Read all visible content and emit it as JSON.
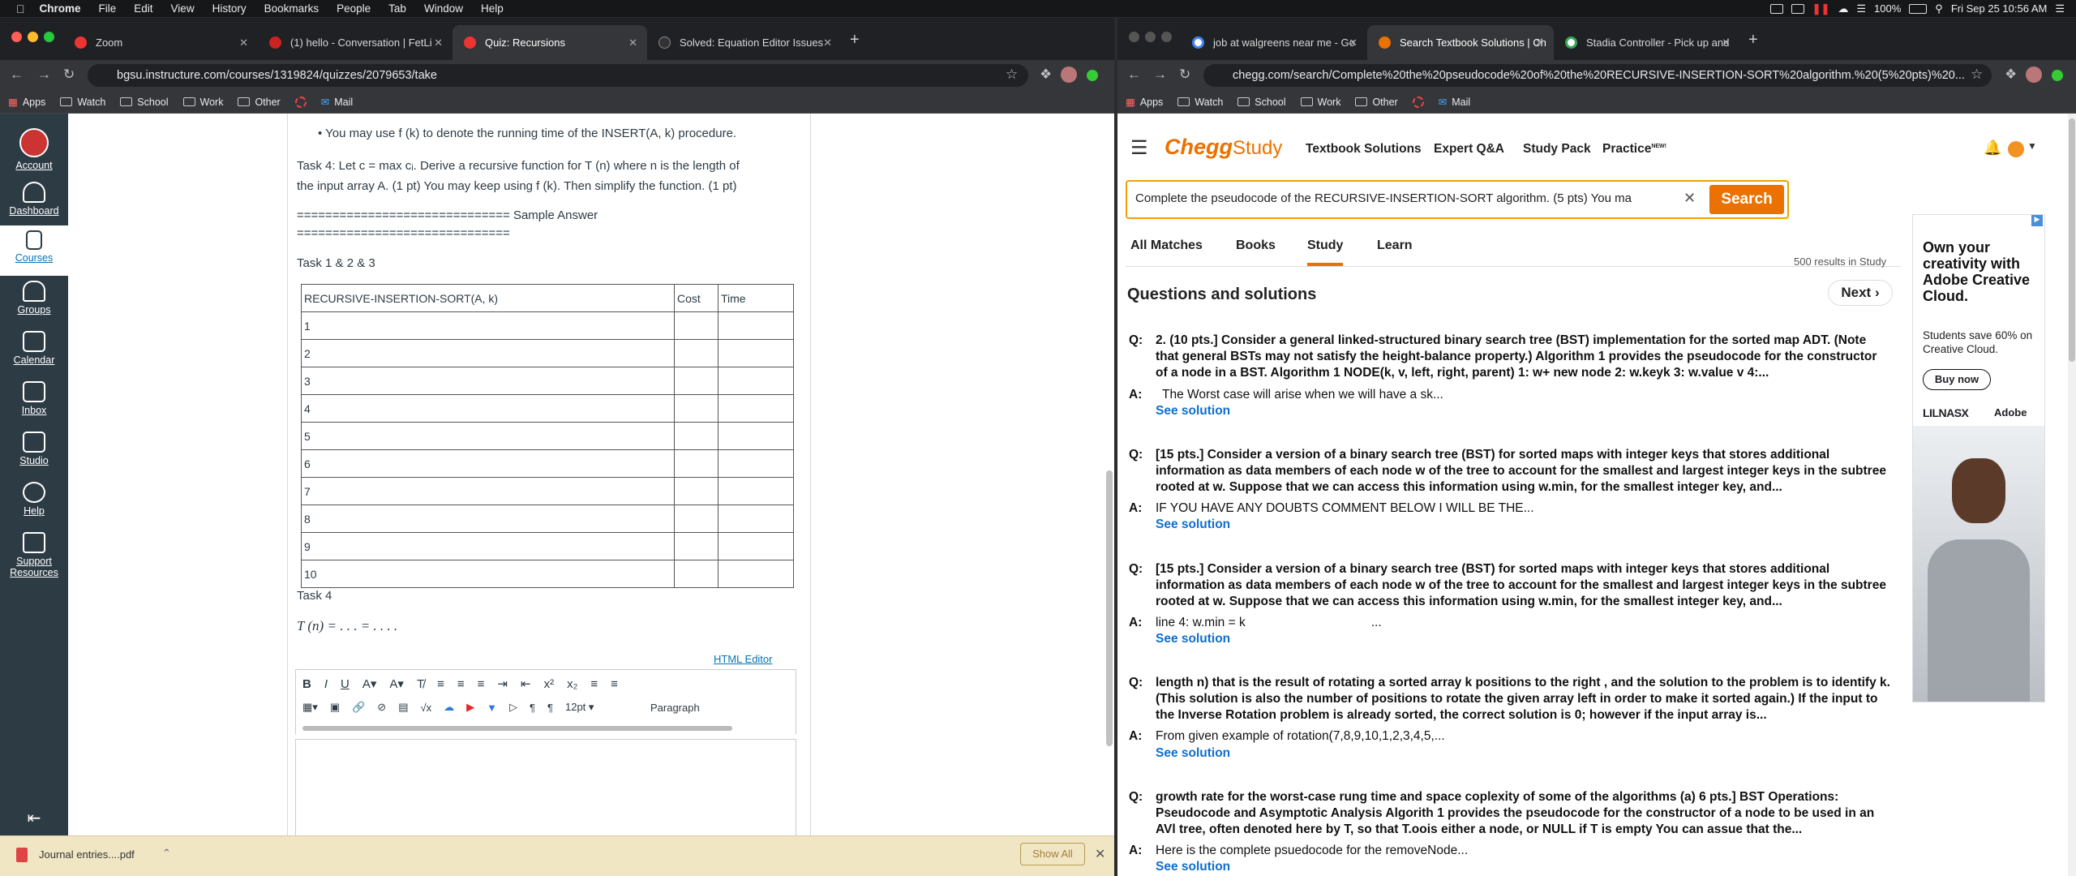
{
  "menubar": {
    "app": "Chrome",
    "items": [
      "File",
      "Edit",
      "View",
      "History",
      "Bookmarks",
      "People",
      "Tab",
      "Window",
      "Help"
    ],
    "battery": "100%",
    "clock": "Fri Sep 25  10:56 AM"
  },
  "left_window": {
    "tabs": [
      {
        "title": "Zoom"
      },
      {
        "title": "(1) hello - Conversation | FetLi"
      },
      {
        "title": "Quiz: Recursions"
      },
      {
        "title": "Solved: Equation Editor Issues"
      }
    ],
    "url": "bgsu.instructure.com/courses/1319824/quizzes/2079653/take",
    "bookmarks": [
      "Apps",
      "Watch",
      "School",
      "Work",
      "Other",
      "",
      "Mail"
    ],
    "nav": [
      {
        "label": "Account"
      },
      {
        "label": "Dashboard"
      },
      {
        "label": "Courses"
      },
      {
        "label": "Groups"
      },
      {
        "label": "Calendar"
      },
      {
        "label": "Inbox"
      },
      {
        "label": "Studio"
      },
      {
        "label": "Help"
      },
      {
        "label": "Support Resources"
      }
    ],
    "quiz": {
      "bullet": "You may use f (k) to denote the running time of the INSERT(A, k) procedure.",
      "task4_line1": "Task 4: Let c = max cᵢ. Derive a recursive function for T (n) where n is the length of",
      "task4_line2": "the input array A. (1 pt) You may keep using f (k).  Then simplify the function. (1 pt)",
      "sep1": "============================== Sample Answer",
      "sep2": "==============================",
      "task123": "Task 1 & 2 & 3",
      "table_header": [
        "RECURSIVE-INSERTION-SORT(A, k)",
        "Cost",
        "Time"
      ],
      "table_rows": [
        "1",
        "2",
        "3",
        "4",
        "5",
        "6",
        "7",
        "8",
        "9",
        "10"
      ],
      "task4": "Task 4",
      "formula": "T (n)  = . . . = . . . .",
      "html_editor": "HTML Editor",
      "font_size": "12pt",
      "paragraph": "Paragraph"
    },
    "download": {
      "file": "Journal entries....pdf",
      "show_all": "Show All"
    }
  },
  "right_window": {
    "tabs": [
      {
        "title": "job at walgreens near me - Go"
      },
      {
        "title": "Search Textbook Solutions | Ch"
      },
      {
        "title": "Stadia Controller - Pick up and"
      }
    ],
    "url": "chegg.com/search/Complete%20the%20pseudocode%20of%20the%20RECURSIVE-INSERTION-SORT%20algorithm.%20(5%20pts)%20...",
    "bookmarks": [
      "Apps",
      "Watch",
      "School",
      "Work",
      "Other",
      "",
      "Mail"
    ],
    "chegg": {
      "logo": "Chegg",
      "logo2": "Study",
      "nav": [
        "Textbook Solutions",
        "Expert Q&A",
        "Study Pack",
        "Practice"
      ],
      "practice_badge": "NEW!",
      "search_value": "Complete the pseudocode of the RECURSIVE-INSERTION-SORT algorithm. (5 pts)  You ma",
      "search_btn": "Search",
      "filters": [
        "All Matches",
        "Books",
        "Study",
        "Learn"
      ],
      "results_count": "500 results in Study",
      "section_title": "Questions and solutions",
      "next": "Next",
      "see_solution": "See solution",
      "questions": [
        {
          "q": "2. (10 pts.] Consider a general linked-structured binary search tree (BST) implementation for the sorted map ADT. (Note that general BSTs may not satisfy the height-balance property.) Algorithm 1 provides the pseudocode for the constructor of a node in a BST. Algorithm 1 NODE(k, v, left, right, parent) 1: w+ new node 2: w.keyk 3: w.value v 4:...",
          "a": "The Worst case will arise when we will have a sk..."
        },
        {
          "q": "[15 pts.] Consider a version of a binary search tree (BST) for sorted maps with integer keys that stores additional information as data members of each node w of the tree to account for the smallest and largest integer keys in the subtree rooted at w. Suppose that we can access this information using w.min, for the smallest integer key, and...",
          "a": "IF YOU HAVE ANY DOUBTS COMMENT BELOW I WILL BE THE..."
        },
        {
          "q": "[15 pts.] Consider a version of a binary search tree (BST) for sorted maps with integer keys that stores additional information as data members of each node w of the tree to account for the smallest and largest integer keys in the subtree rooted at w. Suppose that we can access this information using w.min, for the smallest integer key, and...",
          "a": "line 4: w.min = k                                    ..."
        },
        {
          "q": "length n) that is the result of rotating a sorted array k positions to the right , and the solution to the problem is to identify k. (This solution is also the number of positions to rotate the given array left in order to make it sorted again.) If the input to the Inverse Rotation problem is already sorted, the correct solution is 0; however if the input array is...",
          "a": "From given example of rotation(7,8,9,10,1,2,3,4,5,..."
        },
        {
          "q": "growth rate for the worst-case rung time and space coplexity of some of the algorithms (a) 6 pts.] BST Operations: Pseudocode and Asymptotic Analysis Algorith 1 provides the pseudocode for the constructor of a node to be used in an AVl tree, often denoted here by T, so that T.oois either a node, or NULL if T is empty You can assue that the...",
          "a": "Here is the complete psuedocode for the removeNode..."
        }
      ],
      "ad": {
        "headline": "Own your creativity with Adobe Creative Cloud.",
        "sub": "Students save 60% on Creative Cloud.",
        "cta": "Buy now",
        "brand1": "LILNASX",
        "brand2": "Adobe"
      }
    }
  },
  "colors": {
    "canvas_nav": "#2d3b45",
    "chegg_orange": "#eb7100",
    "link": "#0f6ecd",
    "highlight": "#ffd88f"
  }
}
